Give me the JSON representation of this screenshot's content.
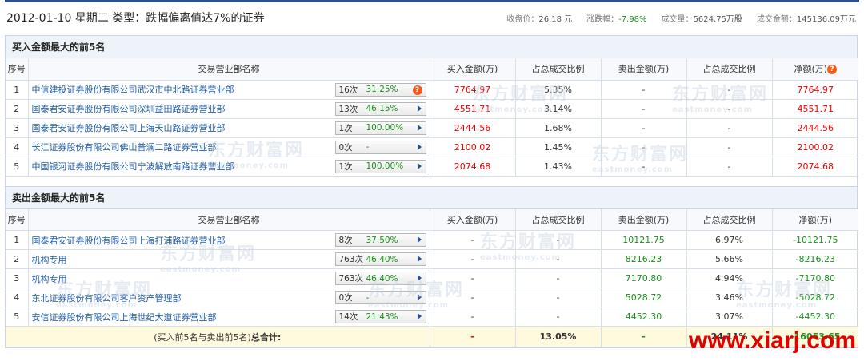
{
  "header": {
    "title": "2012-01-10 星期二  类型：跌幅偏离值达7%的证券",
    "close_label": "收盘价：",
    "close_value": "26.18 元",
    "change_label": "涨跌幅：",
    "change_value": "-7.98%",
    "volume_label": "成交量：",
    "volume_value": "5624.75万股",
    "amount_label": "成交金额：",
    "amount_value": "145136.09万元"
  },
  "columns": {
    "seq": "序号",
    "branch": "交易营业部名称",
    "buy_amount": "买入金额(万)",
    "buy_ratio": "占总成交比例",
    "sell_amount": "卖出金额(万)",
    "sell_ratio": "占总成交比例",
    "net": "净额(万)"
  },
  "buy_section": {
    "title": "买入金额最大的前5名",
    "rows": [
      {
        "seq": "1",
        "name": "中信建投证券股份有限公司武汉市中北路证券营业部",
        "times": "16次",
        "pct": "31.25%",
        "buy": "7764.97",
        "buy_ratio": "5.35%",
        "sell": "-",
        "sell_ratio": "-",
        "net": "7764.97"
      },
      {
        "seq": "2",
        "name": "国泰君安证券股份有限公司深圳益田路证券营业部",
        "times": "13次",
        "pct": "46.15%",
        "buy": "4551.71",
        "buy_ratio": "3.14%",
        "sell": "-",
        "sell_ratio": "-",
        "net": "4551.71"
      },
      {
        "seq": "3",
        "name": "国泰君安证券股份有限公司上海天山路证券营业部",
        "times": "1次",
        "pct": "100.00%",
        "buy": "2444.56",
        "buy_ratio": "1.68%",
        "sell": "-",
        "sell_ratio": "-",
        "net": "2444.56"
      },
      {
        "seq": "4",
        "name": "长江证券股份有限公司佛山普澜二路证券营业部",
        "times": "0次",
        "pct": "-",
        "buy": "2100.02",
        "buy_ratio": "1.45%",
        "sell": "-",
        "sell_ratio": "-",
        "net": "2100.02"
      },
      {
        "seq": "5",
        "name": "中国银河证券股份有限公司宁波解放南路证券营业部",
        "times": "1次",
        "pct": "100.00%",
        "buy": "2074.68",
        "buy_ratio": "1.43%",
        "sell": "-",
        "sell_ratio": "-",
        "net": "2074.68"
      }
    ]
  },
  "sell_section": {
    "title": "卖出金额最大的前5名",
    "rows": [
      {
        "seq": "1",
        "name": "国泰君安证券股份有限公司上海打浦路证券营业部",
        "times": "8次",
        "pct": "37.50%",
        "buy": "-",
        "buy_ratio": "-",
        "sell": "10121.75",
        "sell_ratio": "6.97%",
        "net": "-10121.75"
      },
      {
        "seq": "2",
        "name": "机构专用",
        "times": "763次",
        "pct": "46.40%",
        "buy": "-",
        "buy_ratio": "-",
        "sell": "8216.23",
        "sell_ratio": "5.66%",
        "net": "-8216.23"
      },
      {
        "seq": "3",
        "name": "机构专用",
        "times": "763次",
        "pct": "46.40%",
        "buy": "-",
        "buy_ratio": "-",
        "sell": "7170.80",
        "sell_ratio": "4.94%",
        "net": "-7170.80"
      },
      {
        "seq": "4",
        "name": "东北证券股份有限公司客户资产管理部",
        "times": "0次",
        "pct": "-",
        "buy": "-",
        "buy_ratio": "-",
        "sell": "5028.72",
        "sell_ratio": "3.46%",
        "net": "-5028.72"
      },
      {
        "seq": "5",
        "name": "安信证券股份有限公司上海世纪大道证券营业部",
        "times": "14次",
        "pct": "21.43%",
        "buy": "-",
        "buy_ratio": "-",
        "sell": "4452.30",
        "sell_ratio": "3.07%",
        "net": "-4452.30"
      }
    ]
  },
  "total": {
    "label": "(买入前5名与卖出前5名)",
    "label_bold": "总合计:",
    "buy": "-",
    "buy_ratio": "13.05%",
    "sell": "-",
    "sell_ratio": "24.11%",
    "net": "-16053.65"
  },
  "watermark": {
    "cn": "东方财富网",
    "en": "eastmoney.com"
  },
  "corner_mark": "www.xiarj.com",
  "icons": {
    "help": "question-badge-icon",
    "expand": "play-arrow-icon"
  },
  "colors": {
    "positive": "#e00000",
    "negative": "#1a8f1a",
    "link": "#1f5ca8",
    "accent": "#2b4f8f"
  }
}
